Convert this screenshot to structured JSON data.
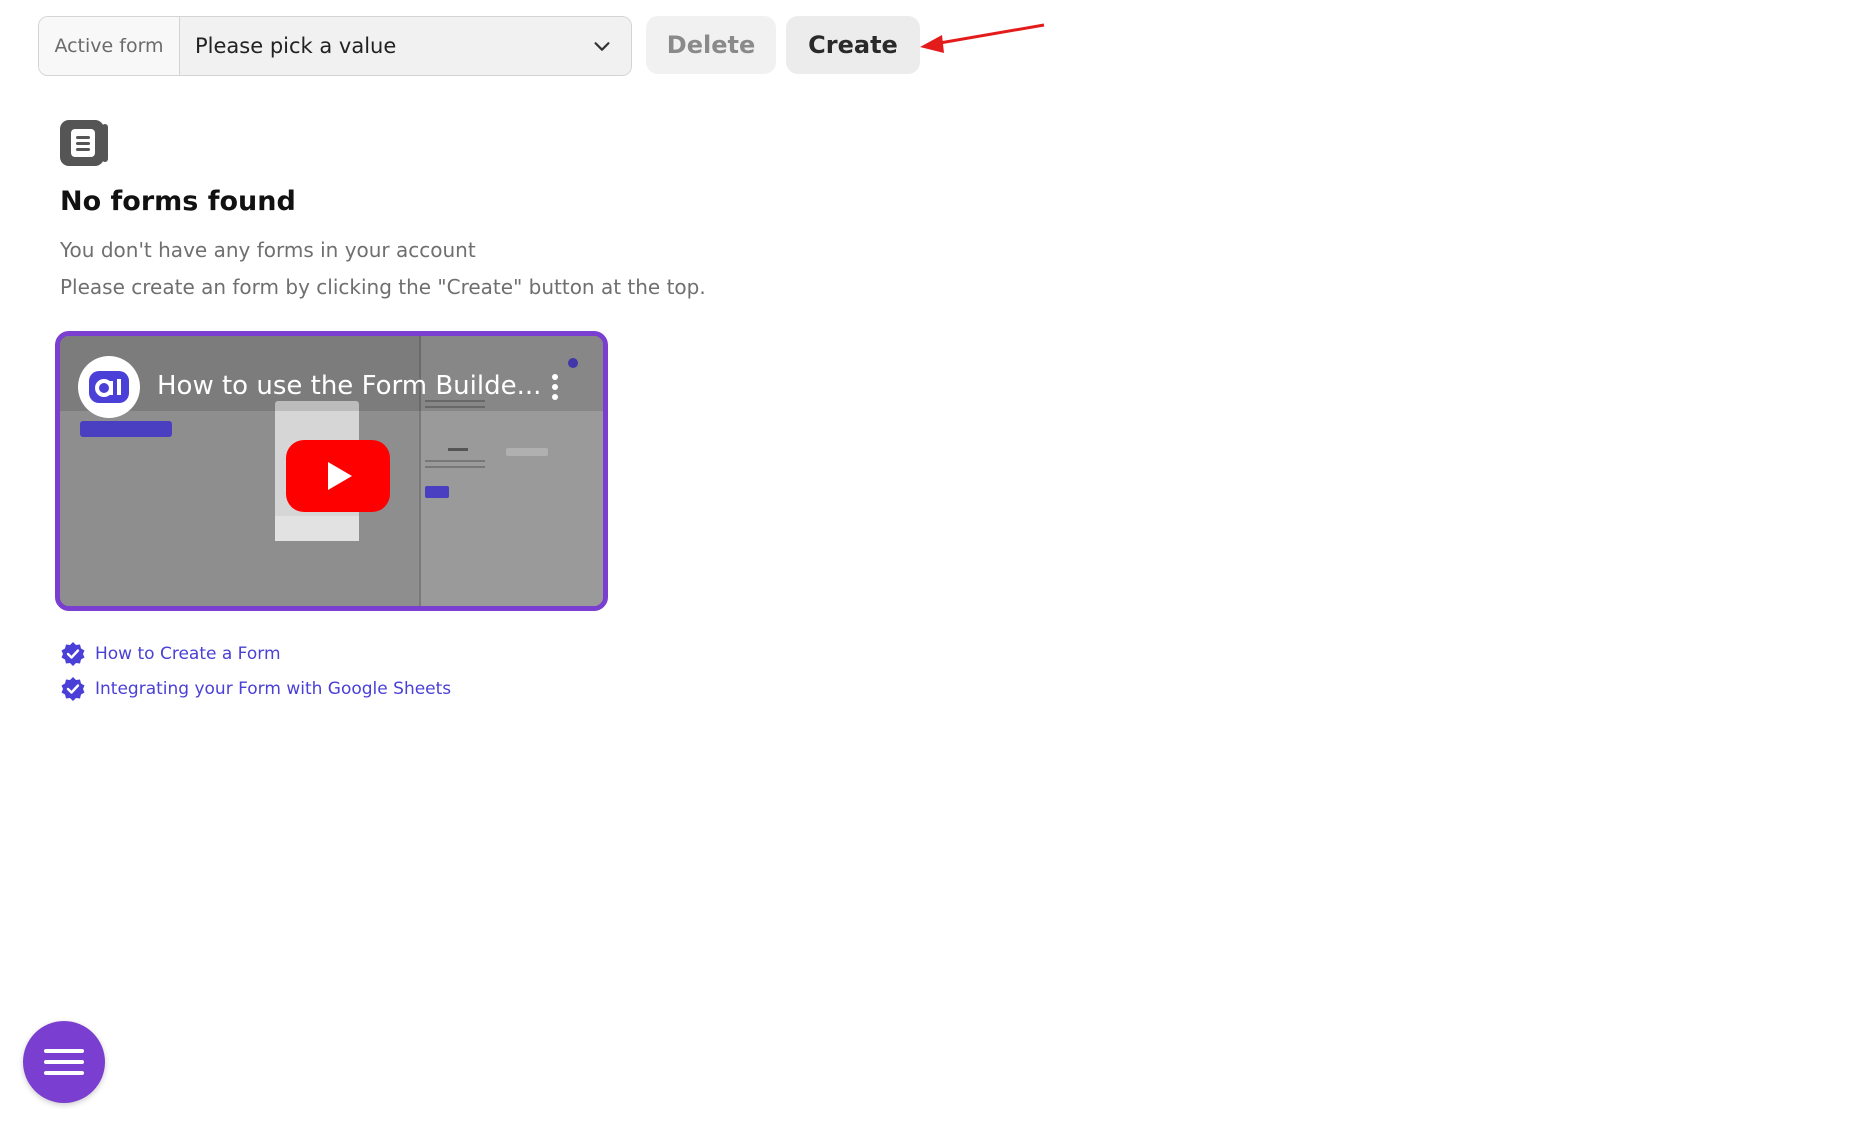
{
  "toolbar": {
    "active_form_label": "Active form",
    "select_placeholder": "Please pick a value",
    "delete_label": "Delete",
    "create_label": "Create"
  },
  "empty_state": {
    "icon": "form-document-icon",
    "title": "No forms found",
    "line1": "You don't have any forms in your account",
    "line2": "Please create an form by clicking the \"Create\" button at the top."
  },
  "video": {
    "title": "How to use the Form Builde...",
    "channel_icon": "ai-logo-icon",
    "play_icon": "youtube-play-icon",
    "border_color": "#7a3fd0"
  },
  "help_links": [
    {
      "label": "How to Create a Form",
      "icon": "verified-check-icon"
    },
    {
      "label": "Integrating your Form with Google Sheets",
      "icon": "verified-check-icon"
    }
  ],
  "colors": {
    "accent": "#7a3fd0",
    "link": "#4a3fd6",
    "annotation_arrow": "#e31b1b"
  },
  "fab": {
    "icon": "menu-icon"
  }
}
